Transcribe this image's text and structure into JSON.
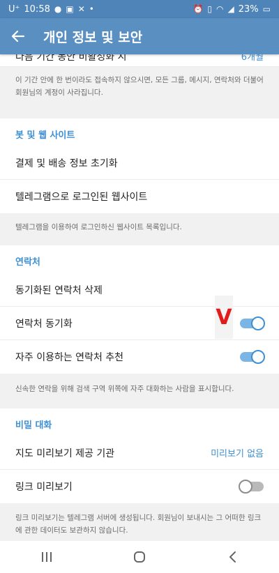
{
  "status_bar": {
    "carrier": "U⁺",
    "time": "10:58",
    "battery": "23%",
    "left_icons": [
      "chat-icon",
      "image-icon",
      "mute-icon",
      "dot-icon"
    ],
    "right_icons": [
      "alarm-icon",
      "vibrate-icon",
      "wifi-icon",
      "signal-icon",
      "battery-icon"
    ]
  },
  "app_bar": {
    "title": "개인 정보 및 보안"
  },
  "partial_row": {
    "label": "다음 기간 동안 비활성화 시",
    "value": "6개월"
  },
  "deletion_info": "이 기간 안에 한 번이라도 접속하지 않으시면, 모든 그룹, 메시지, 연락처와 더불어 회원님의 계정이 사라집니다.",
  "bots_section": {
    "header": "봇 및 웹 사이트",
    "items": [
      {
        "label": "결제 및 배송 정보 초기화"
      },
      {
        "label": "텔레그램으로 로그인된 웹사이트"
      }
    ],
    "info": "텔레그램을 이용하여 로그인하신 웹사이트 목록입니다."
  },
  "contacts_section": {
    "header": "연락처",
    "delete_synced": "동기화된 연락처 삭제",
    "sync_contacts": {
      "label": "연락처 동기화",
      "enabled": true
    },
    "suggest_frequent": {
      "label": "자주 이용하는 연락처 추천",
      "enabled": true
    },
    "info": "신속한 연락을 위해 검색 구역 위쪽에 자주 대화하는 사람을 표시합니다."
  },
  "annotation": {
    "mark": "V",
    "color": "#e21c1c"
  },
  "secret_section": {
    "header": "비밀 대화",
    "map_provider": {
      "label": "지도 미리보기 제공 기관",
      "value": "미리보기 없음"
    },
    "link_preview": {
      "label": "링크 미리보기",
      "enabled": false
    },
    "info": "링크 미리보기는 텔레그램 서버에 생성됩니다. 회원님이 보내시는 그 어떠한 링크에 관한 데이터도 보관하지 않습니다."
  },
  "nav_bar": {
    "buttons": [
      "recent-apps-icon",
      "home-icon",
      "back-icon"
    ]
  },
  "colors": {
    "app_bar": "#5a8fc2",
    "status_bar": "#4f84b8",
    "accent": "#3d8fd6",
    "info_bg": "#f1f1f1"
  }
}
